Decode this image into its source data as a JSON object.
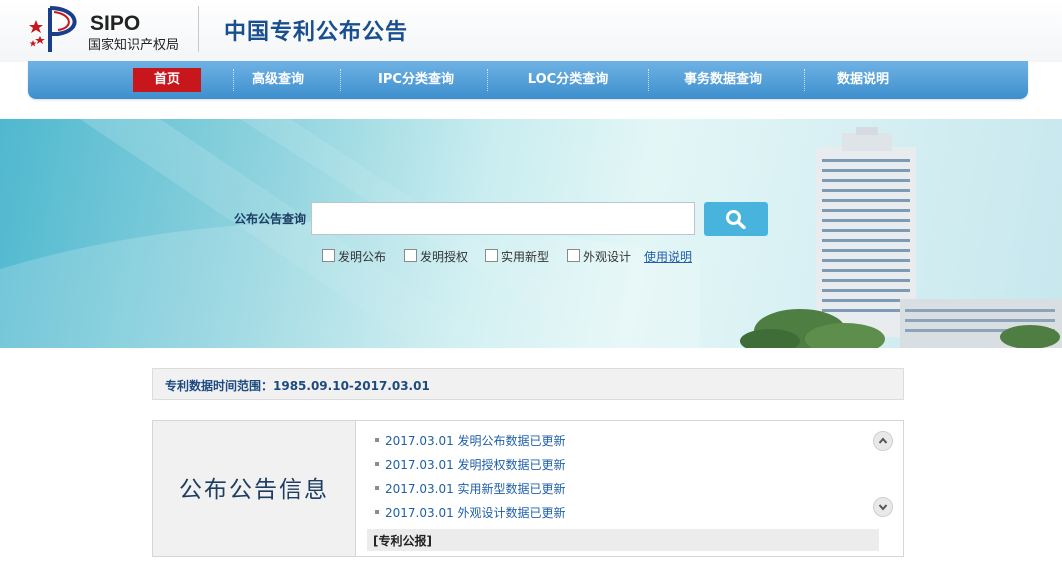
{
  "header": {
    "logo_text": "SIPO",
    "logo_subtitle": "国家知识产权局",
    "site_title": "中国专利公布公告"
  },
  "nav": {
    "items": [
      "首页",
      "高级查询",
      "IPC分类查询",
      "LOC分类查询",
      "事务数据查询",
      "数据说明"
    ],
    "active_index": 0,
    "colors": {
      "bar": "#4a9ad6",
      "active": "#c8161d"
    }
  },
  "search": {
    "label": "公布公告查询",
    "input_value": "",
    "button_icon": "search-icon",
    "filters": [
      "发明公布",
      "发明授权",
      "实用新型",
      "外观设计"
    ],
    "help_link": "使用说明"
  },
  "info": {
    "data_range": "专利数据时间范围：1985.09.10-2017.03.01",
    "panel_title": "公布公告信息",
    "news": [
      "2017.03.01 发明公布数据已更新",
      "2017.03.01 发明授权数据已更新",
      "2017.03.01 实用新型数据已更新",
      "2017.03.01 外观设计数据已更新"
    ],
    "scroll_up_icon": "chevron-up-icon",
    "scroll_down_icon": "chevron-down-icon",
    "gazette_link": "[专利公报]"
  }
}
